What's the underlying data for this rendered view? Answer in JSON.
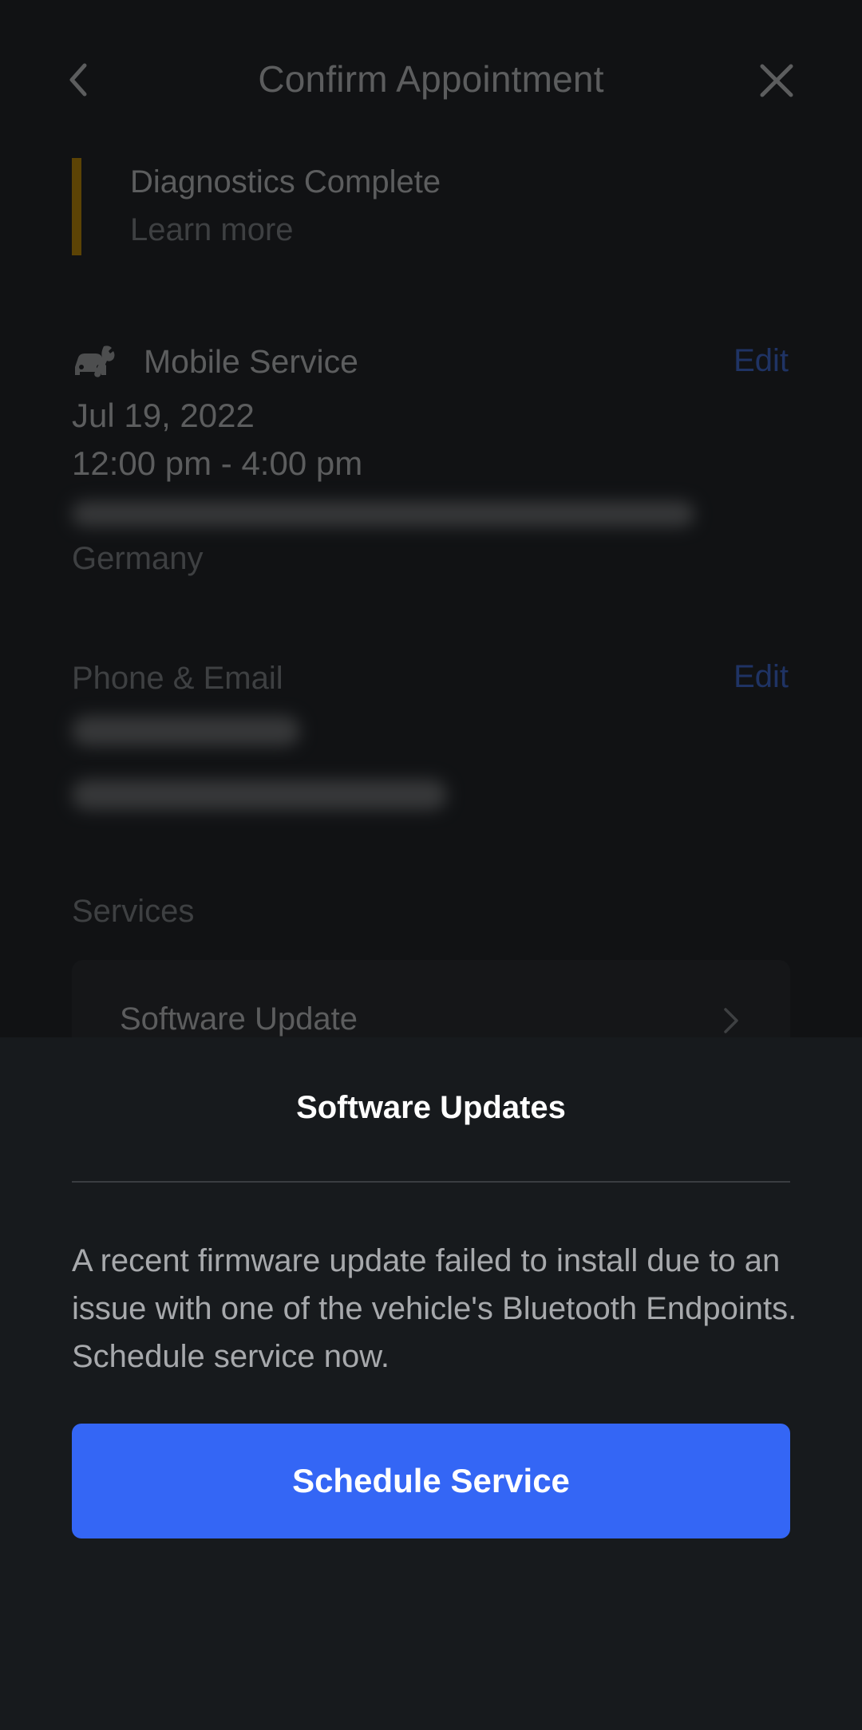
{
  "header": {
    "title": "Confirm Appointment",
    "back_icon": "chevron-left-icon",
    "close_icon": "close-icon"
  },
  "diagnostics": {
    "title": "Diagnostics Complete",
    "link": "Learn more",
    "accent_color": "#b8860b"
  },
  "mobile_service": {
    "icon": "car-wrench-icon",
    "label": "Mobile Service",
    "edit_label": "Edit",
    "date": "Jul 19, 2022",
    "time": "12:00 pm - 4:00 pm",
    "country": "Germany"
  },
  "contact": {
    "label": "Phone & Email",
    "edit_label": "Edit"
  },
  "services": {
    "label": "Services",
    "items": [
      {
        "label": "Software Update"
      }
    ]
  },
  "sheet": {
    "title": "Software Updates",
    "body": "A recent firmware update failed to install due to an issue with one of the vehicle's Bluetooth Endpoints. Schedule service now.",
    "button_label": "Schedule Service",
    "button_color": "#3466f5"
  },
  "colors": {
    "link": "#3e66c9",
    "background": "#171a1d"
  }
}
